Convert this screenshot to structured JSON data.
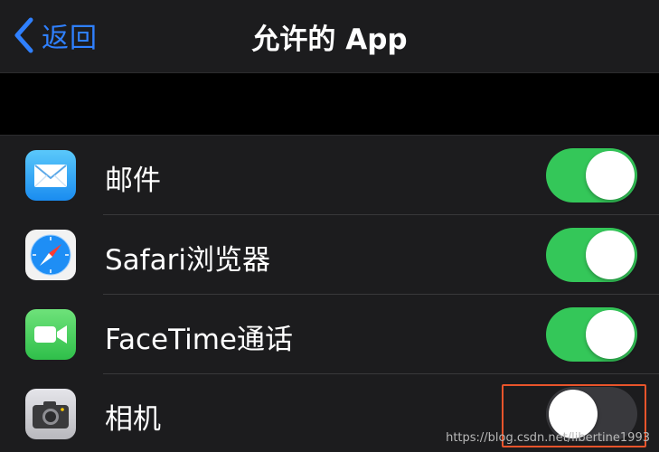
{
  "navbar": {
    "back_label": "返回",
    "title": "允许的 App"
  },
  "apps": [
    {
      "label": "邮件",
      "icon": "mail-icon",
      "enabled": true
    },
    {
      "label": "Safari浏览器",
      "icon": "safari-compass-icon",
      "enabled": true
    },
    {
      "label": "FaceTime通话",
      "icon": "facetime-camera-icon",
      "enabled": true
    },
    {
      "label": "相机",
      "icon": "camera-icon",
      "enabled": false
    }
  ],
  "colors": {
    "accent": "#2f80ff",
    "toggle_on": "#34c759",
    "toggle_off": "#39393d",
    "highlight": "#e8542b"
  },
  "watermark": "https://blog.csdn.net/libertine1993"
}
